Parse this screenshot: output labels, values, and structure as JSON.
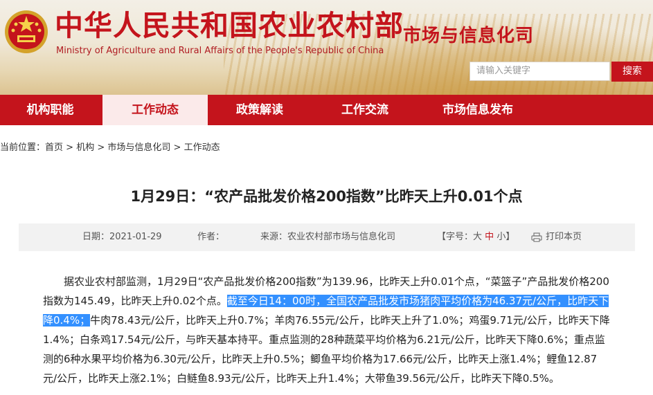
{
  "header": {
    "title_cn": "中华人民共和国农业农村部",
    "title_en": "Ministry of Agriculture and Rural Affairs of the People's Republic of China",
    "department": "市场与信息化司",
    "emblem_icon": "national-emblem-icon"
  },
  "search": {
    "placeholder": "请输入关键字",
    "button_label": "搜索"
  },
  "nav": {
    "items": [
      {
        "label": "机构职能"
      },
      {
        "label": "工作动态",
        "active": true
      },
      {
        "label": "政策解读"
      },
      {
        "label": "工作交流"
      },
      {
        "label": "市场信息发布"
      }
    ]
  },
  "breadcrumb": {
    "prefix": "当前位置：",
    "items": [
      "首页",
      "机构",
      "市场与信息化司",
      "工作动态"
    ],
    "separator": " > "
  },
  "article": {
    "title": "1月29日：“农产品批发价格200指数”比昨天上升0.01个点",
    "meta": {
      "date_label": "日期：2021-01-29",
      "author_label": "作者：",
      "source_label": "来源：农业农村部市场与信息化司",
      "font_label_open": "【字号：",
      "font_large": "大",
      "font_medium": "中",
      "font_small": "小",
      "font_label_close": "】",
      "print_label": "打印本页"
    },
    "body_before": "据农业农村部监测，1月29日“农产品批发价格200指数”为139.96，比昨天上升0.01个点，“菜篮子”产品批发价格200指数为145.49，比昨天上升0.02个点。",
    "body_highlight": "截至今日14：00时，全国农产品批发市场猪肉平均价格为46.37元/公斤，比昨天下降0.4%；",
    "body_after": "牛肉78.43元/公斤，比昨天上升0.7%；羊肉76.55元/公斤，比昨天上升了1.0%；鸡蛋9.71元/公斤，比昨天下降1.4%；白条鸡17.54元/公斤，与昨天基本持平。重点监测的28种蔬菜平均价格为6.21元/公斤，比昨天下降0.6%；重点监测的6种水果平均价格为6.30元/公斤，比昨天上升0.5%；鲫鱼平均价格为17.66元/公斤，比昨天上涨1.4%；鲤鱼12.87元/公斤，比昨天上涨2.1%；白鲢鱼8.93元/公斤，比昨天上升1.4%；大带鱼39.56元/公斤，比昨天下降0.5%。"
  },
  "colors": {
    "brand_red": "#c4141c",
    "highlight": "#3390ff"
  }
}
